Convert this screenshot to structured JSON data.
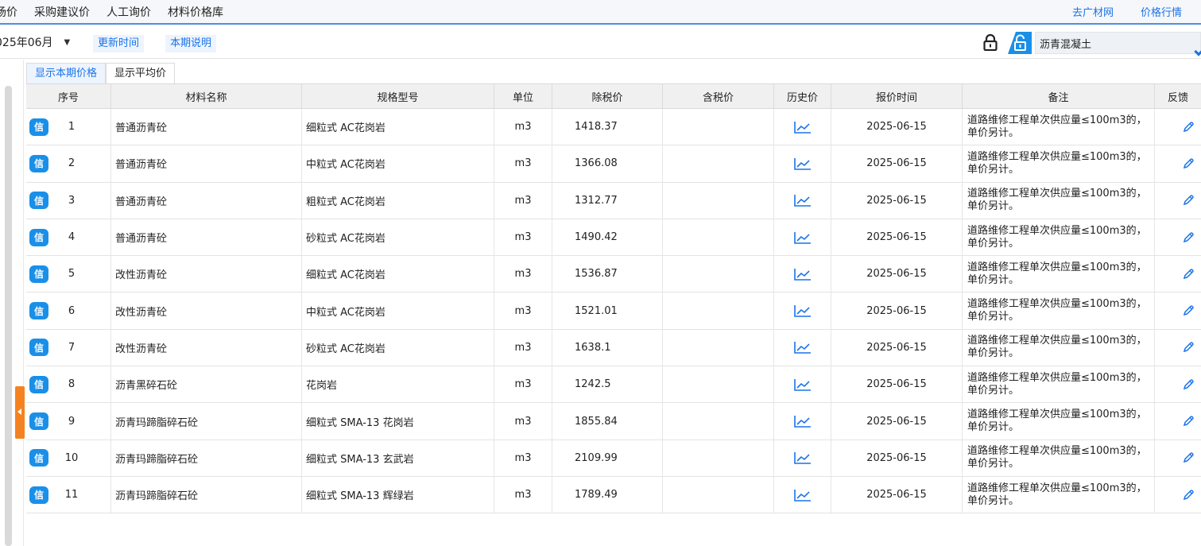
{
  "nav": {
    "items": [
      "场价",
      "采购建议价",
      "人工询价",
      "材料价格库"
    ],
    "links": [
      "去广材网",
      "价格行情"
    ]
  },
  "toolbar": {
    "period": "025年06月",
    "update_time": "更新时间",
    "period_note": "本期说明",
    "search_value": "沥青混凝土"
  },
  "tabs": [
    "显示本期价格",
    "显示平均价"
  ],
  "table": {
    "headers": [
      "序号",
      "材料名称",
      "规格型号",
      "单位",
      "除税价",
      "含税价",
      "历史价",
      "报价时间",
      "备注",
      "反馈"
    ],
    "badge": "信",
    "rows": [
      {
        "seq": "1",
        "name": "普通沥青砼",
        "spec": "细粒式 AC花岗岩",
        "unit": "m3",
        "ex_tax": "1418.37",
        "in_tax": "",
        "date": "2025-06-15",
        "note": "道路维修工程单次供应量≤100m3的，单价另计。"
      },
      {
        "seq": "2",
        "name": "普通沥青砼",
        "spec": "中粒式 AC花岗岩",
        "unit": "m3",
        "ex_tax": "1366.08",
        "in_tax": "",
        "date": "2025-06-15",
        "note": "道路维修工程单次供应量≤100m3的，单价另计。"
      },
      {
        "seq": "3",
        "name": "普通沥青砼",
        "spec": "粗粒式 AC花岗岩",
        "unit": "m3",
        "ex_tax": "1312.77",
        "in_tax": "",
        "date": "2025-06-15",
        "note": "道路维修工程单次供应量≤100m3的，单价另计。"
      },
      {
        "seq": "4",
        "name": "普通沥青砼",
        "spec": "砂粒式 AC花岗岩",
        "unit": "m3",
        "ex_tax": "1490.42",
        "in_tax": "",
        "date": "2025-06-15",
        "note": "道路维修工程单次供应量≤100m3的，单价另计。"
      },
      {
        "seq": "5",
        "name": "改性沥青砼",
        "spec": "细粒式 AC花岗岩",
        "unit": "m3",
        "ex_tax": "1536.87",
        "in_tax": "",
        "date": "2025-06-15",
        "note": "道路维修工程单次供应量≤100m3的，单价另计。"
      },
      {
        "seq": "6",
        "name": "改性沥青砼",
        "spec": "中粒式 AC花岗岩",
        "unit": "m3",
        "ex_tax": "1521.01",
        "in_tax": "",
        "date": "2025-06-15",
        "note": "道路维修工程单次供应量≤100m3的，单价另计。"
      },
      {
        "seq": "7",
        "name": "改性沥青砼",
        "spec": "砂粒式 AC花岗岩",
        "unit": "m3",
        "ex_tax": "1638.1",
        "in_tax": "",
        "date": "2025-06-15",
        "note": "道路维修工程单次供应量≤100m3的，单价另计。"
      },
      {
        "seq": "8",
        "name": "沥青黑碎石砼",
        "spec": "花岗岩",
        "unit": "m3",
        "ex_tax": "1242.5",
        "in_tax": "",
        "date": "2025-06-15",
        "note": "道路维修工程单次供应量≤100m3的，单价另计。"
      },
      {
        "seq": "9",
        "name": "沥青玛蹄脂碎石砼",
        "spec": "细粒式 SMA-13 花岗岩",
        "unit": "m3",
        "ex_tax": "1855.84",
        "in_tax": "",
        "date": "2025-06-15",
        "note": "道路维修工程单次供应量≤100m3的，单价另计。"
      },
      {
        "seq": "10",
        "name": "沥青玛蹄脂碎石砼",
        "spec": "细粒式 SMA-13 玄武岩",
        "unit": "m3",
        "ex_tax": "2109.99",
        "in_tax": "",
        "date": "2025-06-15",
        "note": "道路维修工程单次供应量≤100m3的，单价另计。"
      },
      {
        "seq": "11",
        "name": "沥青玛蹄脂碎石砼",
        "spec": "细粒式 SMA-13 辉绿岩",
        "unit": "m3",
        "ex_tax": "1789.49",
        "in_tax": "",
        "date": "2025-06-15",
        "note": "道路维修工程单次供应量≤100m3的，单价另计。"
      }
    ]
  },
  "colors": {
    "accent": "#1a73e8",
    "badge": "#1a8fe8",
    "handle": "#f58220"
  },
  "icons": {
    "history": "trend-chart-icon",
    "feedback": "pencil-icon",
    "lock": "lock-icon",
    "unlock": "unlock-icon"
  }
}
